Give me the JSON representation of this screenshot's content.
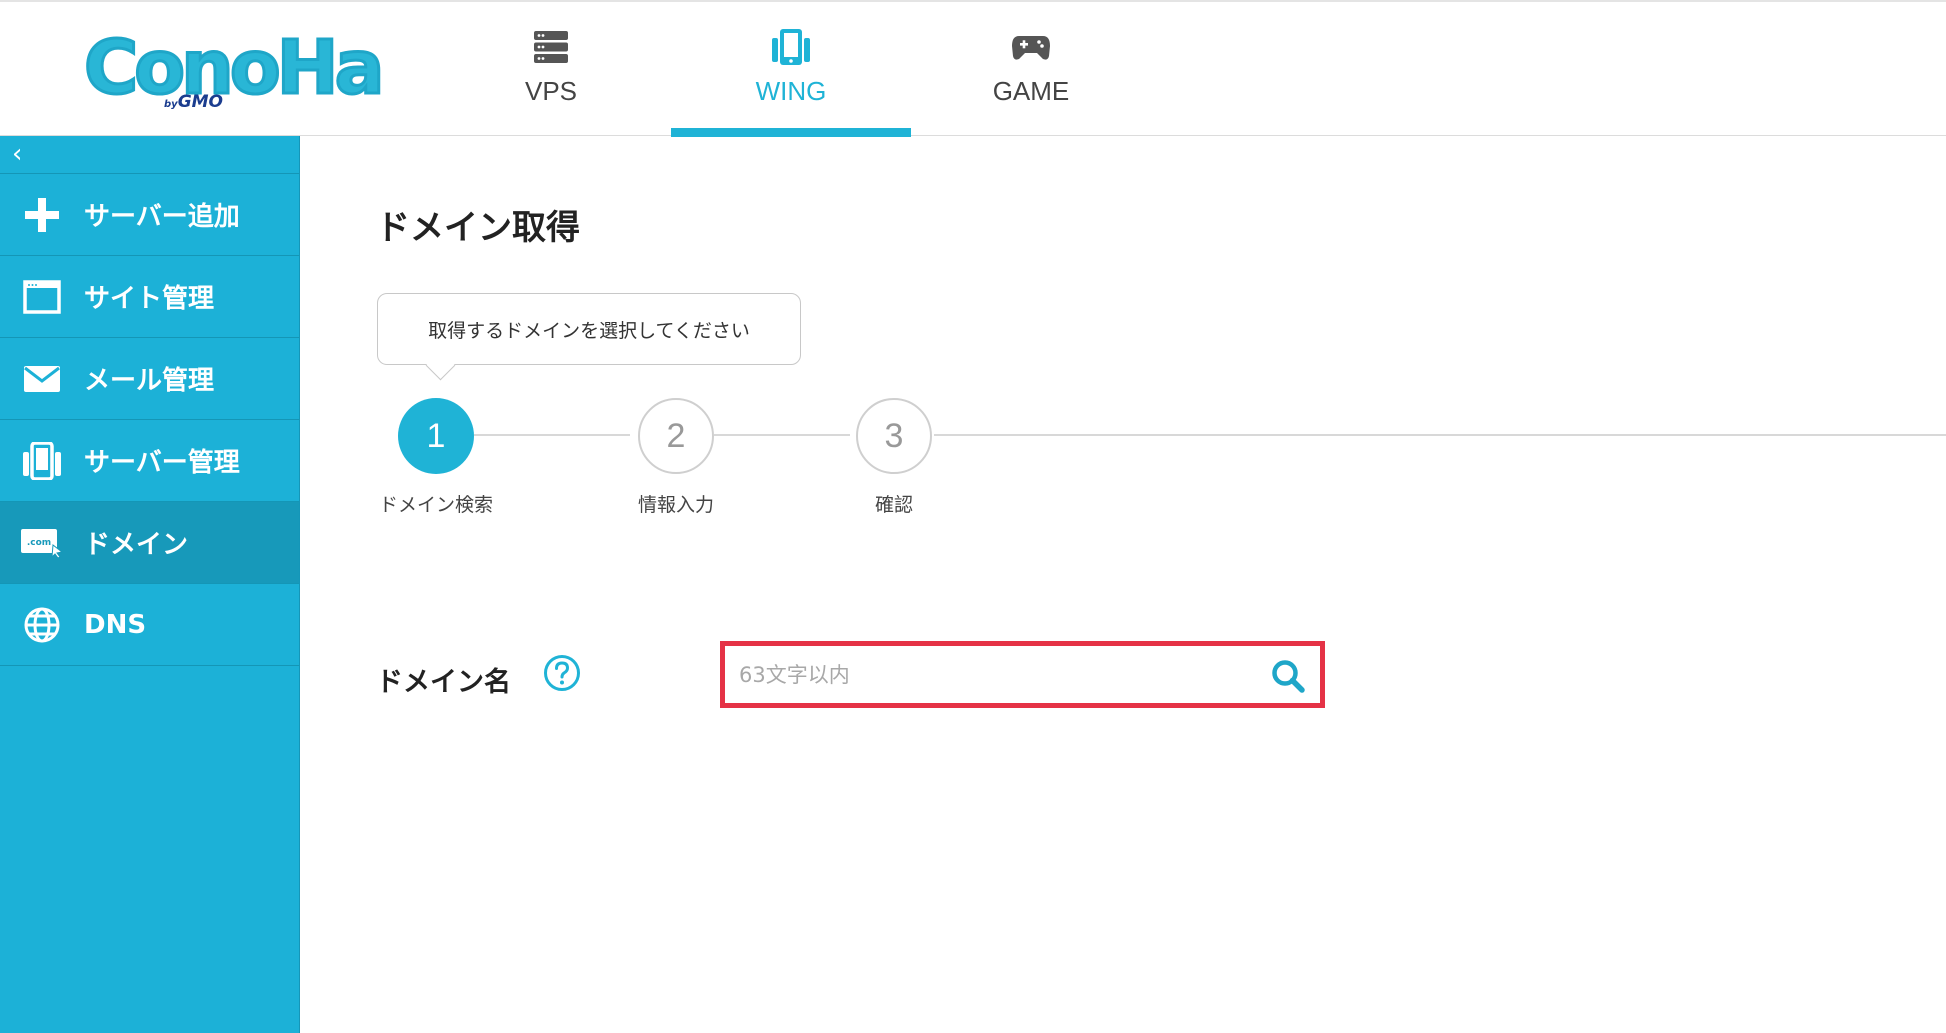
{
  "header": {
    "logo_main": "ConoHa",
    "logo_sub_prefix": "by",
    "logo_sub": "GMO",
    "tabs": [
      {
        "label": "VPS",
        "icon": "server-rack-icon",
        "active": false
      },
      {
        "label": "WING",
        "icon": "mobile-server-icon",
        "active": true
      },
      {
        "label": "GAME",
        "icon": "gamepad-icon",
        "active": false
      }
    ]
  },
  "sidebar": {
    "collapse_label": "‹",
    "items": [
      {
        "label": "サーバー追加",
        "icon": "plus-icon",
        "active": false
      },
      {
        "label": "サイト管理",
        "icon": "browser-window-icon",
        "active": false
      },
      {
        "label": "メール管理",
        "icon": "envelope-icon",
        "active": false
      },
      {
        "label": "サーバー管理",
        "icon": "server-icon",
        "active": false
      },
      {
        "label": "ドメイン",
        "icon": "domain-com-icon",
        "active": true
      },
      {
        "label": "DNS",
        "icon": "globe-icon",
        "active": false
      }
    ]
  },
  "main": {
    "title": "ドメイン取得",
    "tooltip": "取得するドメインを選択してください",
    "steps": [
      {
        "number": "1",
        "label": "ドメイン検索",
        "active": true
      },
      {
        "number": "2",
        "label": "情報入力",
        "active": false
      },
      {
        "number": "3",
        "label": "確認",
        "active": false
      }
    ],
    "domain_field": {
      "label": "ドメイン名",
      "value": "",
      "placeholder": "63文字以内"
    }
  },
  "colors": {
    "accent": "#1fb3d6",
    "sidebar_bg": "#1cb1d7",
    "sidebar_active": "#1799ba",
    "highlight_border": "#e53246"
  }
}
